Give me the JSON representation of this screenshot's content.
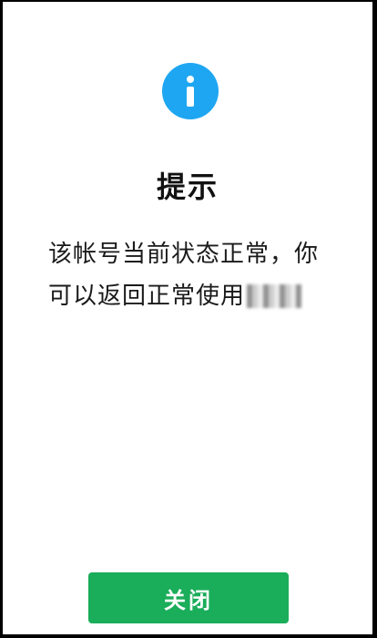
{
  "dialog": {
    "icon": "info-icon",
    "title": "提示",
    "message_line1": "该帐号当前状态正常，你",
    "message_line2": "可以返回正常使用",
    "redacted_text": "",
    "close_label": "关闭"
  },
  "colors": {
    "accent_blue": "#1ea6f2",
    "button_green": "#1aad5a",
    "text": "#1a1a1a",
    "background": "#ffffff"
  }
}
